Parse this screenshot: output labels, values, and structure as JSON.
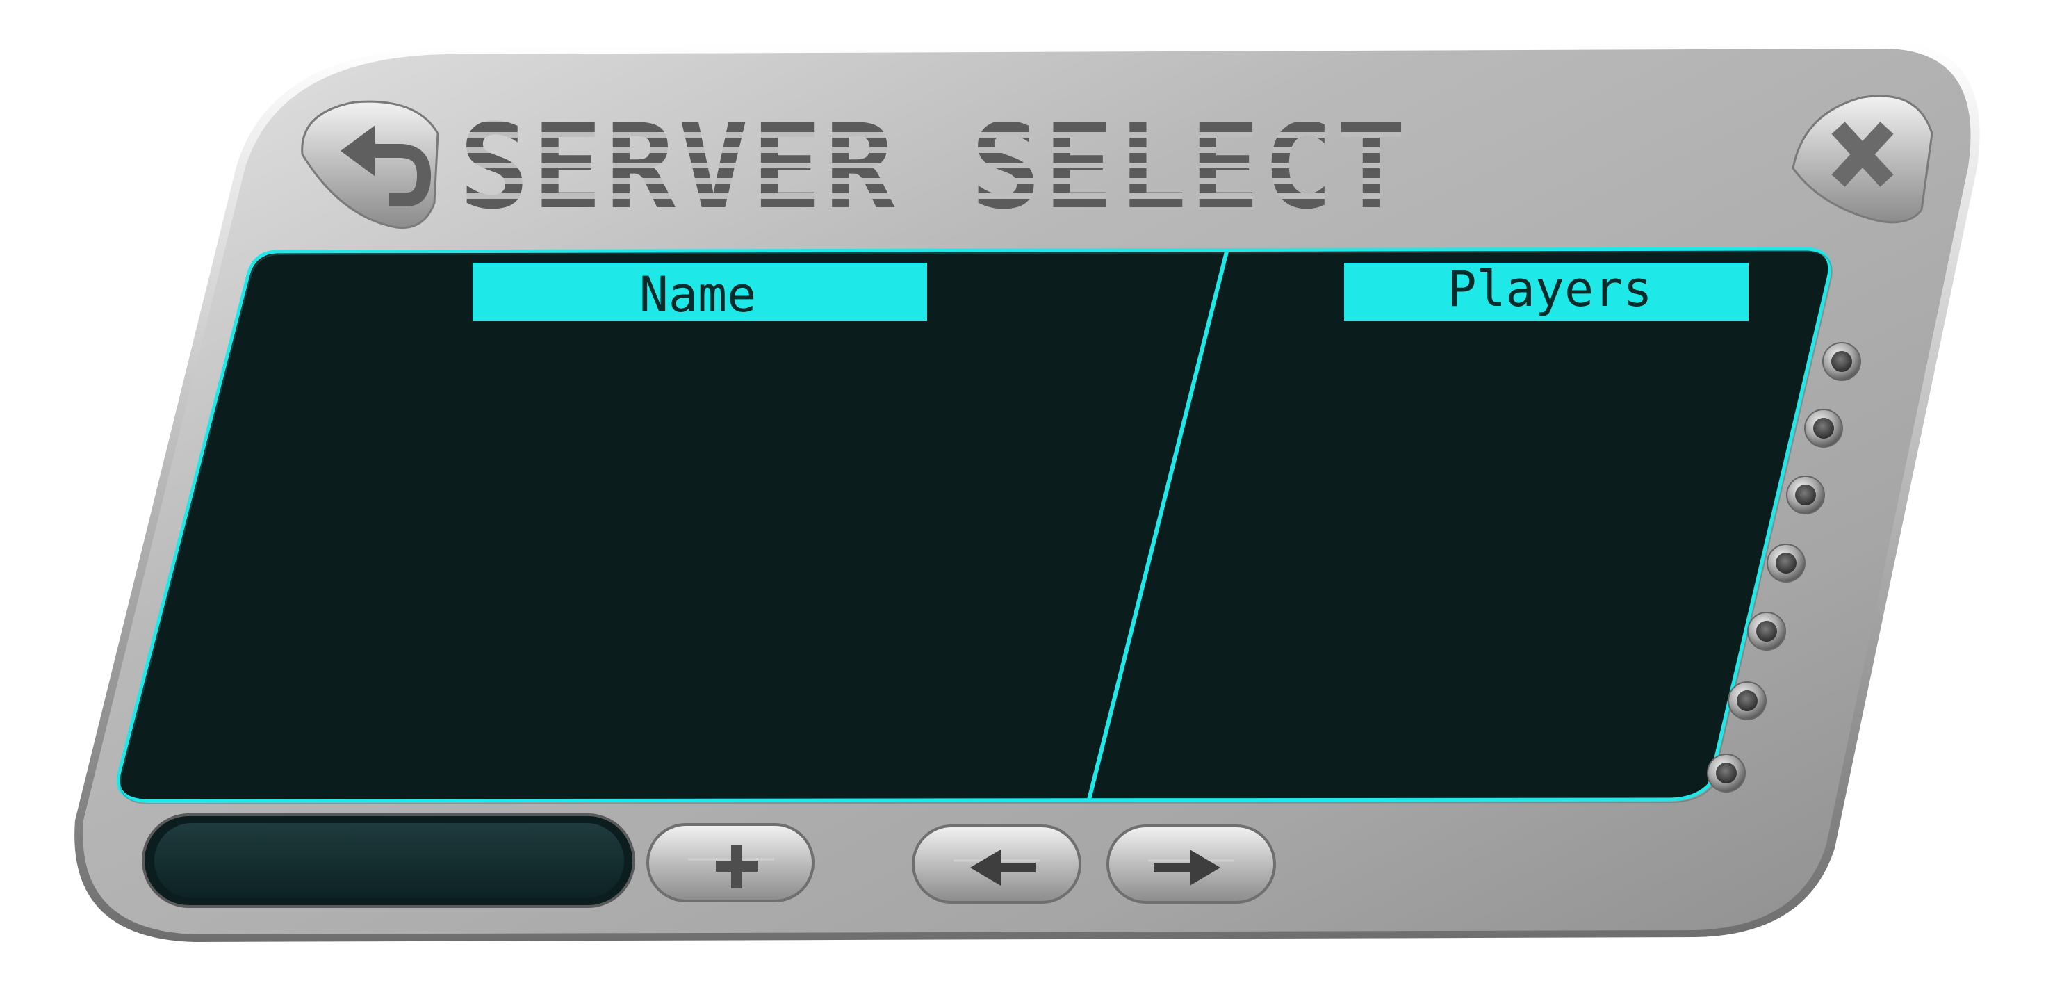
{
  "window": {
    "title": "SERVER SELECT"
  },
  "table": {
    "columns": [
      {
        "label": "Name"
      },
      {
        "label": "Players"
      }
    ],
    "rows": []
  },
  "scroll_indicator": {
    "dot_count": 7
  },
  "controls": {
    "back_icon": "undo-arrow-icon",
    "close_icon": "x-icon",
    "add_icon": "plus-icon",
    "prev_icon": "arrow-left-icon",
    "next_icon": "arrow-right-icon",
    "address_field": {
      "value": ""
    }
  },
  "colors": {
    "accent": "#1ee8e8",
    "screen": "#0a1c1c",
    "frame": "#b4b4b4"
  }
}
